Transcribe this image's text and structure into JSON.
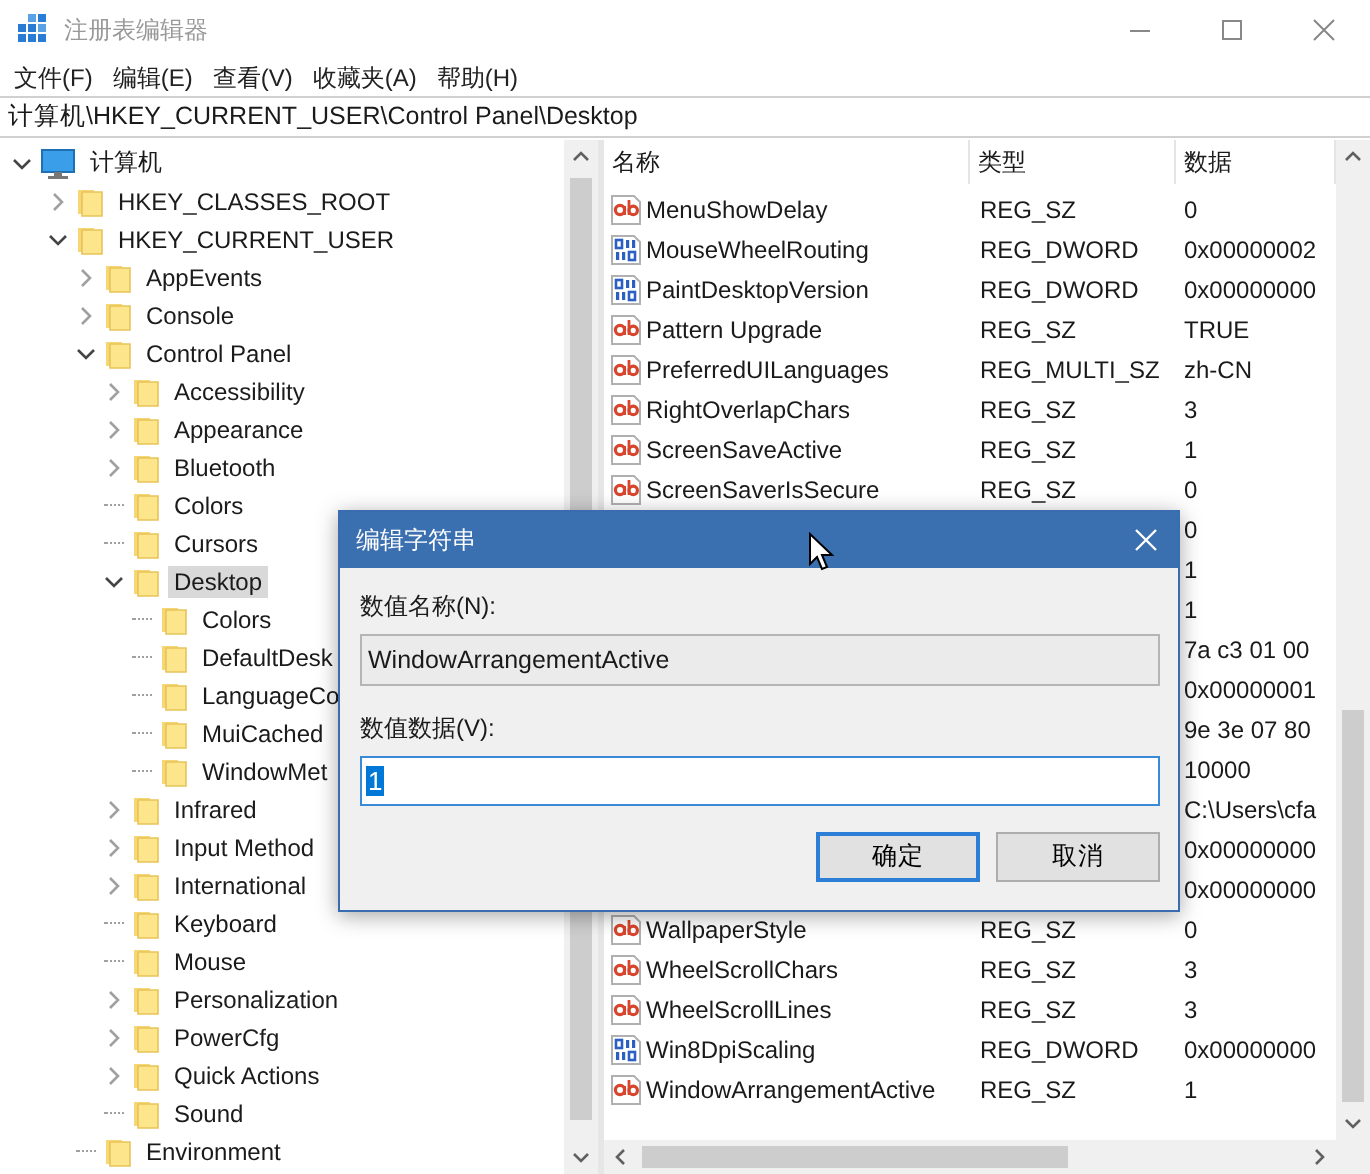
{
  "window": {
    "title": "注册表编辑器"
  },
  "menu": [
    "文件(F)",
    "编辑(E)",
    "查看(V)",
    "收藏夹(A)",
    "帮助(H)"
  ],
  "address": "计算机\\HKEY_CURRENT_USER\\Control Panel\\Desktop",
  "tree": {
    "label": "计算机",
    "kind": "computer",
    "expandable": true,
    "expanded": true,
    "selected": false,
    "children": [
      {
        "label": "HKEY_CLASSES_ROOT",
        "expandable": true,
        "expanded": false,
        "selected": false
      },
      {
        "label": "HKEY_CURRENT_USER",
        "expandable": true,
        "expanded": true,
        "selected": false,
        "children": [
          {
            "label": "AppEvents",
            "expandable": true,
            "expanded": false,
            "selected": false
          },
          {
            "label": "Console",
            "expandable": true,
            "expanded": false,
            "selected": false
          },
          {
            "label": "Control Panel",
            "expandable": true,
            "expanded": true,
            "selected": false,
            "children": [
              {
                "label": "Accessibility",
                "expandable": true,
                "expanded": false,
                "selected": false
              },
              {
                "label": "Appearance",
                "expandable": true,
                "expanded": false,
                "selected": false
              },
              {
                "label": "Bluetooth",
                "expandable": true,
                "expanded": false,
                "selected": false
              },
              {
                "label": "Colors",
                "expandable": false,
                "selected": false
              },
              {
                "label": "Cursors",
                "expandable": false,
                "selected": false
              },
              {
                "label": "Desktop",
                "expandable": true,
                "expanded": true,
                "selected": true,
                "children": [
                  {
                    "label": "Colors",
                    "expandable": false,
                    "selected": false
                  },
                  {
                    "label": "DefaultDesk",
                    "expandable": false,
                    "selected": false
                  },
                  {
                    "label": "LanguageCo",
                    "expandable": false,
                    "selected": false
                  },
                  {
                    "label": "MuiCached",
                    "expandable": false,
                    "selected": false
                  },
                  {
                    "label": "WindowMet",
                    "expandable": false,
                    "selected": false
                  }
                ]
              },
              {
                "label": "Infrared",
                "expandable": true,
                "expanded": false,
                "selected": false
              },
              {
                "label": "Input Method",
                "expandable": true,
                "expanded": false,
                "selected": false
              },
              {
                "label": "International",
                "expandable": true,
                "expanded": false,
                "selected": false
              },
              {
                "label": "Keyboard",
                "expandable": false,
                "selected": false
              },
              {
                "label": "Mouse",
                "expandable": false,
                "selected": false
              },
              {
                "label": "Personalization",
                "expandable": true,
                "expanded": false,
                "selected": false
              },
              {
                "label": "PowerCfg",
                "expandable": true,
                "expanded": false,
                "selected": false
              },
              {
                "label": "Quick Actions",
                "expandable": true,
                "expanded": false,
                "selected": false
              },
              {
                "label": "Sound",
                "expandable": false,
                "selected": false
              }
            ]
          },
          {
            "label": "Environment",
            "expandable": false,
            "selected": false
          }
        ]
      }
    ]
  },
  "values": {
    "columns": [
      "名称",
      "类型",
      "数据"
    ],
    "rows": [
      {
        "kind": "sz",
        "name": "MenuShowDelay",
        "type": "REG_SZ",
        "data": "0"
      },
      {
        "kind": "dword",
        "name": "MouseWheelRouting",
        "type": "REG_DWORD",
        "data": "0x00000002"
      },
      {
        "kind": "dword",
        "name": "PaintDesktopVersion",
        "type": "REG_DWORD",
        "data": "0x00000000"
      },
      {
        "kind": "sz",
        "name": "Pattern Upgrade",
        "type": "REG_SZ",
        "data": "TRUE"
      },
      {
        "kind": "multi_sz",
        "name": "PreferredUILanguages",
        "type": "REG_MULTI_SZ",
        "data": "zh-CN"
      },
      {
        "kind": "sz",
        "name": "RightOverlapChars",
        "type": "REG_SZ",
        "data": "3"
      },
      {
        "kind": "sz",
        "name": "ScreenSaveActive",
        "type": "REG_SZ",
        "data": "1"
      },
      {
        "kind": "sz",
        "name": "ScreenSaverIsSecure",
        "type": "REG_SZ",
        "data": "0"
      },
      {
        "data": "0"
      },
      {
        "data": "1"
      },
      {
        "data": "1"
      },
      {
        "data": "7a c3 01 00"
      },
      {
        "data": "0x00000001"
      },
      {
        "data": "9e 3e 07 80"
      },
      {
        "data": "10000"
      },
      {
        "data": "C:\\Users\\cfa"
      },
      {
        "data": "0x00000000"
      },
      {
        "data": "0x00000000"
      },
      {
        "kind": "sz",
        "name": "WallpaperStyle",
        "type": "REG_SZ",
        "data": "0"
      },
      {
        "kind": "sz",
        "name": "WheelScrollChars",
        "type": "REG_SZ",
        "data": "3"
      },
      {
        "kind": "sz",
        "name": "WheelScrollLines",
        "type": "REG_SZ",
        "data": "3"
      },
      {
        "kind": "dword",
        "name": "Win8DpiScaling",
        "type": "REG_DWORD",
        "data": "0x00000000"
      },
      {
        "kind": "sz",
        "name": "WindowArrangementActive",
        "type": "REG_SZ",
        "data": "1"
      }
    ]
  },
  "dialog": {
    "title": "编辑字符串",
    "name_label": "数值名称(N):",
    "name_value": "WindowArrangementActive",
    "data_label": "数值数据(V):",
    "data_value": "1",
    "data_value_selected": true,
    "buttons": [
      {
        "label": "确定",
        "default": true
      },
      {
        "label": "取消",
        "default": false
      }
    ]
  }
}
